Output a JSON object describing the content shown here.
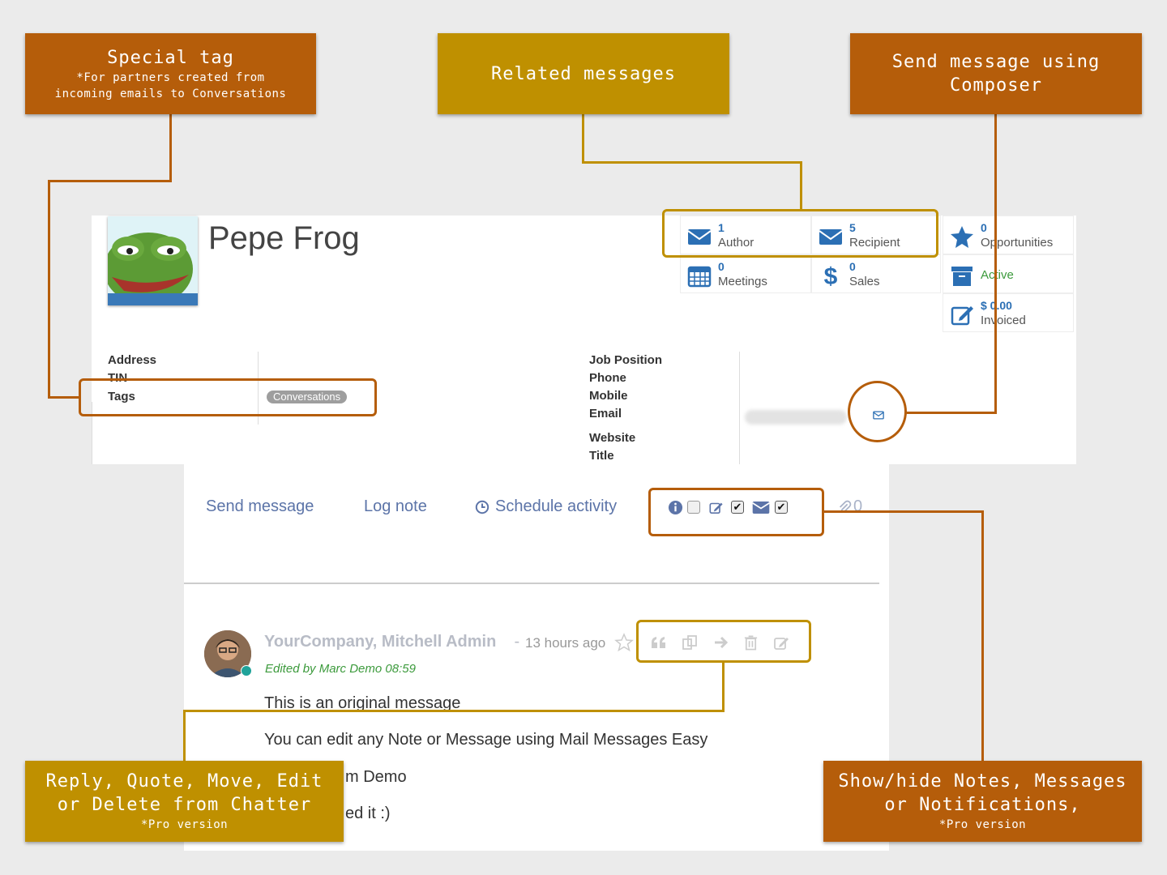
{
  "callouts": {
    "special_tag": {
      "title": "Special tag",
      "sub1": "*For partners created from",
      "sub2": "incoming emails to Conversations"
    },
    "related_messages": {
      "title": "Related messages"
    },
    "send_composer": {
      "title1": "Send message using",
      "title2": "Composer"
    },
    "reply_quote": {
      "title1": "Reply, Quote, Move, Edit",
      "title2": "or Delete from Chatter",
      "sub": "*Pro version"
    },
    "show_hide": {
      "title1": "Show/hide Notes, Messages",
      "title2": "or Notifications,",
      "sub": "*Pro version"
    }
  },
  "partner": {
    "name": "Pepe Frog",
    "stats": [
      {
        "num": "1",
        "label": "Author"
      },
      {
        "num": "5",
        "label": "Recipient"
      },
      {
        "num": "0",
        "label": "Opportunities"
      },
      {
        "num": "0",
        "label": "Meetings"
      },
      {
        "num": "0",
        "label": "Sales"
      },
      {
        "num": "",
        "label": "Active"
      },
      {
        "num": "$ 0.00",
        "label": "Invoiced"
      }
    ],
    "left_fields": {
      "address": "Address",
      "tin": "TIN",
      "tags": "Tags"
    },
    "tag_value": "Conversations",
    "right_fields": {
      "job": "Job Position",
      "phone": "Phone",
      "mobile": "Mobile",
      "email": "Email",
      "website": "Website",
      "title": "Title"
    }
  },
  "chatter": {
    "send_message": "Send message",
    "log_note": "Log note",
    "schedule_activity": "Schedule activity",
    "attachments": "0",
    "message": {
      "author": "YourCompany, Mitchell Admin",
      "sep": " - ",
      "time": "13 hours ago",
      "edited": "Edited by Marc Demo 08:59",
      "line1": "This is an original message",
      "line2": "You can edit any Note or Message using Mail Messages Easy",
      "line3": "m Demo",
      "line4": "ed it :)"
    }
  },
  "colors": {
    "orange": "#b55d0a",
    "gold": "#bf9000",
    "link": "#5c74a8",
    "blue": "#2b6fb4"
  }
}
